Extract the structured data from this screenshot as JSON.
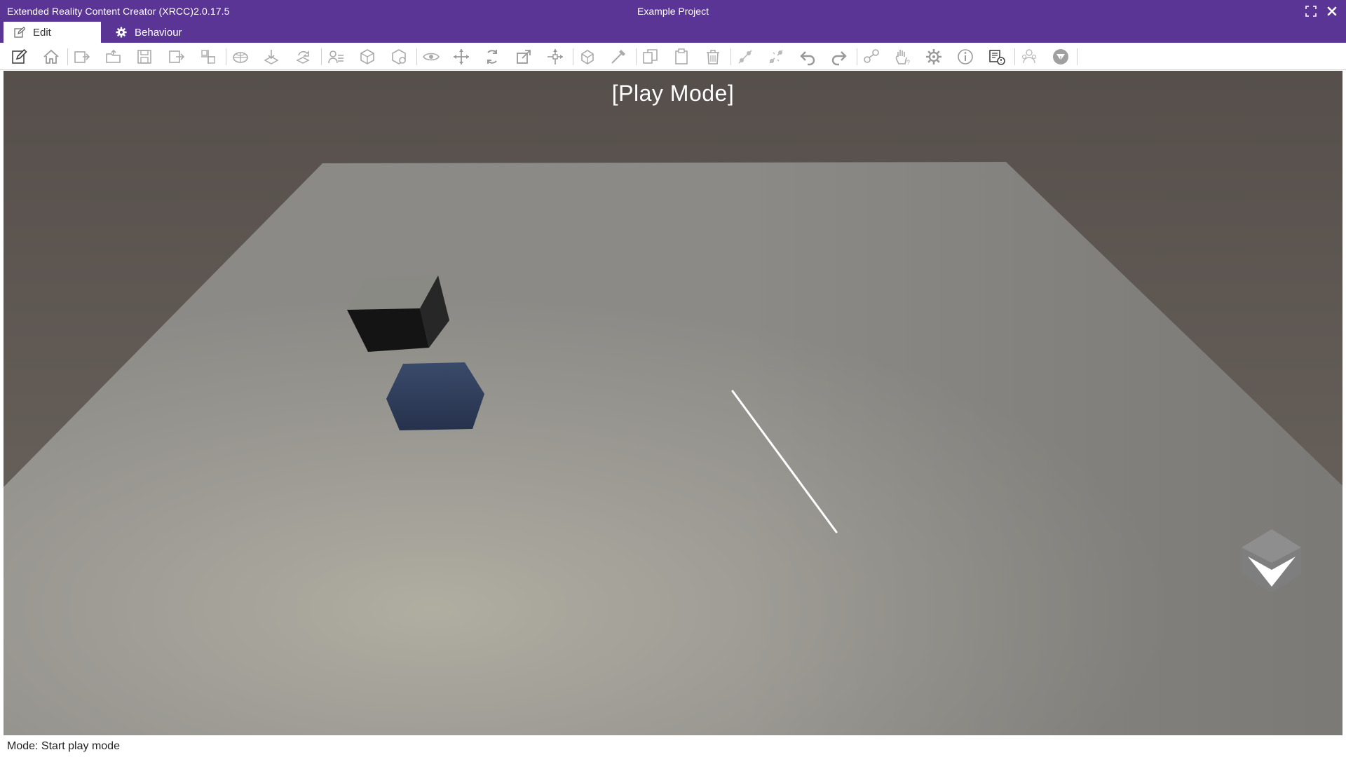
{
  "window": {
    "app_title": "Extended Reality Content Creator (XRCC)2.0.17.5",
    "project_title": "Example Project",
    "maximize_icon": "maximize-icon",
    "close_icon": "close-icon"
  },
  "tabs": [
    {
      "label": "Edit",
      "icon": "edit-icon",
      "active": true
    },
    {
      "label": "Behaviour",
      "icon": "gear-icon",
      "active": false
    }
  ],
  "toolbar": {
    "tools": [
      "edit-tool",
      "home",
      "import",
      "open",
      "save",
      "export",
      "add-object",
      "environment",
      "place",
      "rotate-view",
      "layers",
      "package",
      "material",
      "view",
      "move",
      "rotate",
      "scale",
      "pivot",
      "snap",
      "measure",
      "copy",
      "paste",
      "delete",
      "link",
      "unlink",
      "undo",
      "redo",
      "connect",
      "grab",
      "settings",
      "info",
      "report",
      "characters",
      "help"
    ]
  },
  "viewport": {
    "mode_label": "[Play Mode]",
    "orientation_gizmo": "view-cube-icon",
    "colors": {
      "background": "#5e5752",
      "floor": "#9a9893",
      "black_cube": "#1a1a1a",
      "blue_cube": "#2f3d5c",
      "pointer_ray": "#ffffff"
    }
  },
  "status": {
    "text": "Mode: Start play mode"
  },
  "theme": {
    "accent": "#5a3596"
  }
}
